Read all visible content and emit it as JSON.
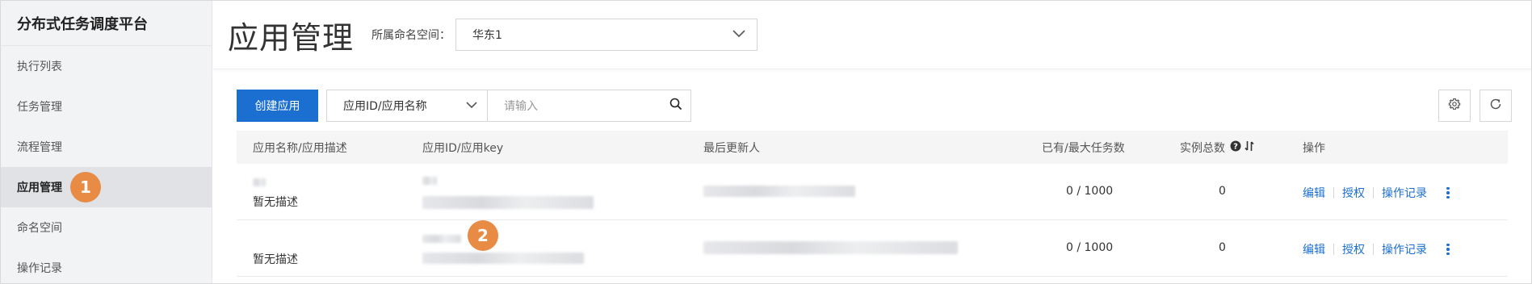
{
  "sidebar": {
    "title": "分布式任务调度平台",
    "items": [
      {
        "label": "执行列表"
      },
      {
        "label": "任务管理"
      },
      {
        "label": "流程管理"
      },
      {
        "label": "应用管理",
        "active": true,
        "badge": "1"
      },
      {
        "label": "命名空间"
      },
      {
        "label": "操作记录"
      }
    ]
  },
  "header": {
    "title": "应用管理",
    "namespace_label": "所属命名空间：",
    "namespace_value": "华东1"
  },
  "toolbar": {
    "create_label": "创建应用",
    "field_select_value": "应用ID/应用名称",
    "search_placeholder": "请输入",
    "icons": [
      "search-icon",
      "settings-icon",
      "refresh-icon"
    ]
  },
  "table": {
    "columns": [
      "应用名称/应用描述",
      "应用ID/应用key",
      "最后更新人",
      "已有/最大任务数",
      "实例总数",
      "操作"
    ],
    "rows": [
      {
        "description": "暂无描述",
        "task_count": "0 / 1000",
        "instances": "0",
        "actions": [
          "编辑",
          "授权",
          "操作记录"
        ]
      },
      {
        "description": "暂无描述",
        "task_count": "0 / 1000",
        "instances": "0",
        "actions": [
          "编辑",
          "授权",
          "操作记录"
        ],
        "badge": "2"
      }
    ]
  },
  "colors": {
    "primary": "#1b6fd1",
    "badge": "#e88b45",
    "sidebar_bg": "#f2f3f5"
  }
}
